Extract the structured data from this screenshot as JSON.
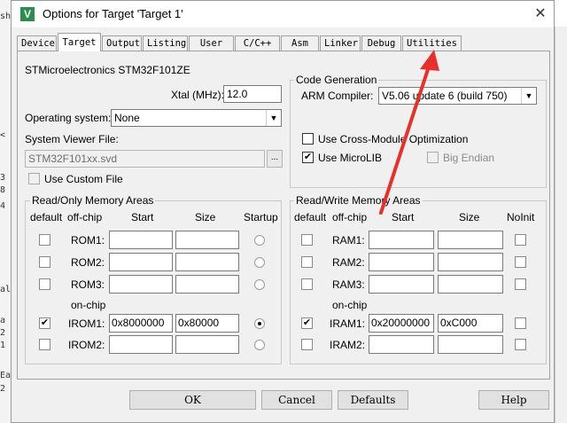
{
  "background_editor": {
    "gutter_chars": [
      "sh",
      "<",
      "3",
      "8",
      "4",
      "al",
      "a",
      "2",
      "1",
      "Ea",
      "2"
    ]
  },
  "dialog": {
    "title": "Options for Target 'Target 1'",
    "close_label": "✕"
  },
  "tabs": [
    {
      "label": "Device"
    },
    {
      "label": "Target"
    },
    {
      "label": "Output"
    },
    {
      "label": "Listing"
    },
    {
      "label": "User"
    },
    {
      "label": "C/C++"
    },
    {
      "label": "Asm"
    },
    {
      "label": "Linker"
    },
    {
      "label": "Debug"
    },
    {
      "label": "Utilities"
    }
  ],
  "target": {
    "device_name": "STMicroelectronics STM32F101ZE",
    "xtal_label": "Xtal (MHz):",
    "xtal_value": "12.0",
    "os_label": "Operating system:",
    "os_value": "None",
    "svd_label": "System Viewer File:",
    "svd_value": "STM32F101xx.svd",
    "browse_label": "...",
    "custom_file_label": "Use Custom File",
    "code_gen": {
      "legend": "Code Generation",
      "compiler_label": "ARM Compiler:",
      "compiler_value": "V5.06 update 6 (build 750)",
      "cross_module_label": "Use Cross-Module Optimization",
      "microlib_label": "Use MicroLIB",
      "big_endian_label": "Big Endian"
    },
    "rom": {
      "legend": "Read/Only Memory Areas",
      "headers": {
        "default": "default",
        "offchip": "off-chip",
        "start": "Start",
        "size": "Size",
        "startup": "Startup"
      },
      "onchip_label": "on-chip",
      "rows": [
        {
          "name": "ROM1:",
          "start": "",
          "size": "",
          "default": false,
          "startup": false
        },
        {
          "name": "ROM2:",
          "start": "",
          "size": "",
          "default": false,
          "startup": false
        },
        {
          "name": "ROM3:",
          "start": "",
          "size": "",
          "default": false,
          "startup": false
        },
        {
          "name": "IROM1:",
          "start": "0x8000000",
          "size": "0x80000",
          "default": true,
          "startup": true
        },
        {
          "name": "IROM2:",
          "start": "",
          "size": "",
          "default": false,
          "startup": false
        }
      ]
    },
    "ram": {
      "legend": "Read/Write Memory Areas",
      "headers": {
        "default": "default",
        "offchip": "off-chip",
        "start": "Start",
        "size": "Size",
        "noinit": "NoInit"
      },
      "onchip_label": "on-chip",
      "rows": [
        {
          "name": "RAM1:",
          "start": "",
          "size": "",
          "default": false
        },
        {
          "name": "RAM2:",
          "start": "",
          "size": "",
          "default": false
        },
        {
          "name": "RAM3:",
          "start": "",
          "size": "",
          "default": false
        },
        {
          "name": "IRAM1:",
          "start": "0x20000000",
          "size": "0xC000",
          "default": true
        },
        {
          "name": "IRAM2:",
          "start": "",
          "size": "",
          "default": false
        }
      ]
    }
  },
  "buttons": {
    "ok": "OK",
    "cancel": "Cancel",
    "defaults": "Defaults",
    "help": "Help"
  },
  "annotation": {
    "arrow_color": "#e8302a"
  }
}
